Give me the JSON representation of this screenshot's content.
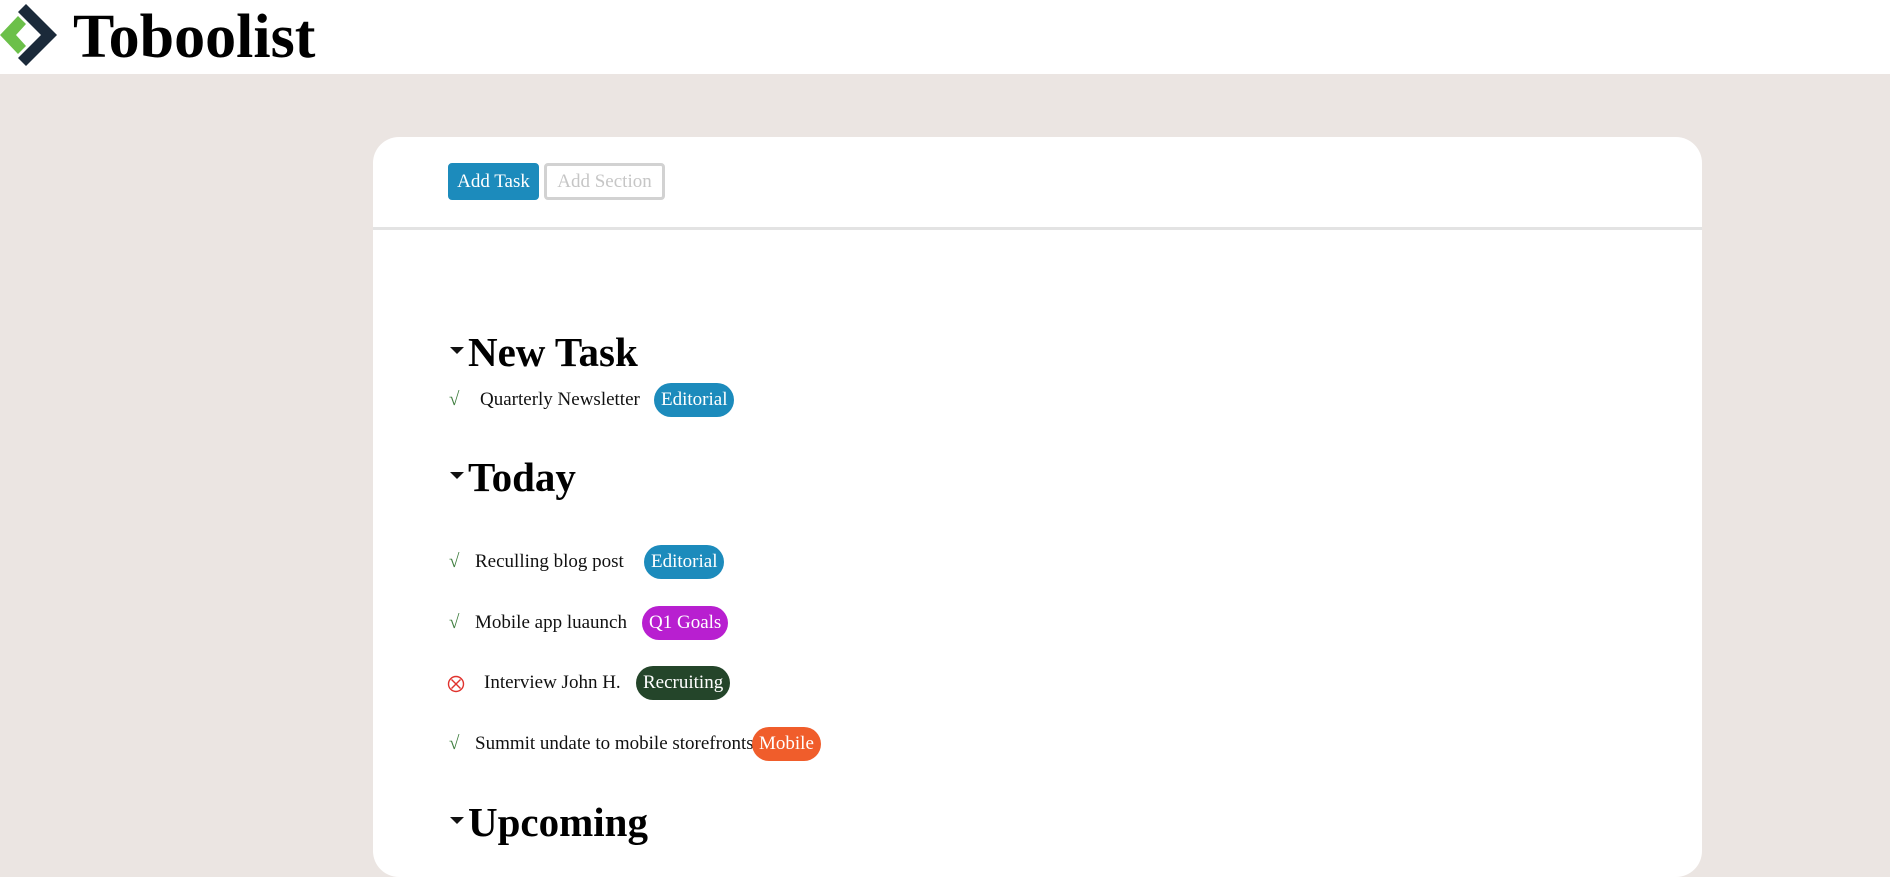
{
  "app": {
    "title": "Toboolist",
    "logo_icon": "diamond-chevron-logo-icon",
    "colors": {
      "logo_green": "#6cc04a",
      "logo_navy": "#1b2a3a"
    }
  },
  "toolbar": {
    "add_task_label": "Add Task",
    "add_section_label": "Add Section"
  },
  "colors": {
    "background": "#ebe5e2",
    "primary": "#1c8bbc",
    "check": "#3e7d3e",
    "blocked": "#e0322d"
  },
  "sections": [
    {
      "title": "New Task",
      "caret_icon": "caret-down-icon",
      "tasks": [
        {
          "status": "done",
          "status_glyph": "√",
          "label": "Quarterly Newsletter",
          "tag": "Editorial",
          "tag_color": "#1c8bbc"
        }
      ]
    },
    {
      "title": "Today",
      "caret_icon": "caret-down-icon",
      "tasks": [
        {
          "status": "done",
          "status_glyph": "√",
          "label": "Reculling blog post",
          "tag": "Editorial",
          "tag_color": "#1c8bbc"
        },
        {
          "status": "done",
          "status_glyph": "√",
          "label": "Mobile app luaunch",
          "tag": "Q1 Goals",
          "tag_color": "#b81fd0"
        },
        {
          "status": "blocked",
          "status_glyph": "⊗",
          "label": "Interview John H.",
          "tag": "Recruiting",
          "tag_color": "#24452a"
        },
        {
          "status": "done",
          "status_glyph": "√",
          "label": "Summit undate to mobile storefronts",
          "tag": "Mobile",
          "tag_color": "#f05d2b"
        }
      ]
    },
    {
      "title": "Upcoming",
      "caret_icon": "caret-down-icon",
      "tasks": []
    }
  ]
}
